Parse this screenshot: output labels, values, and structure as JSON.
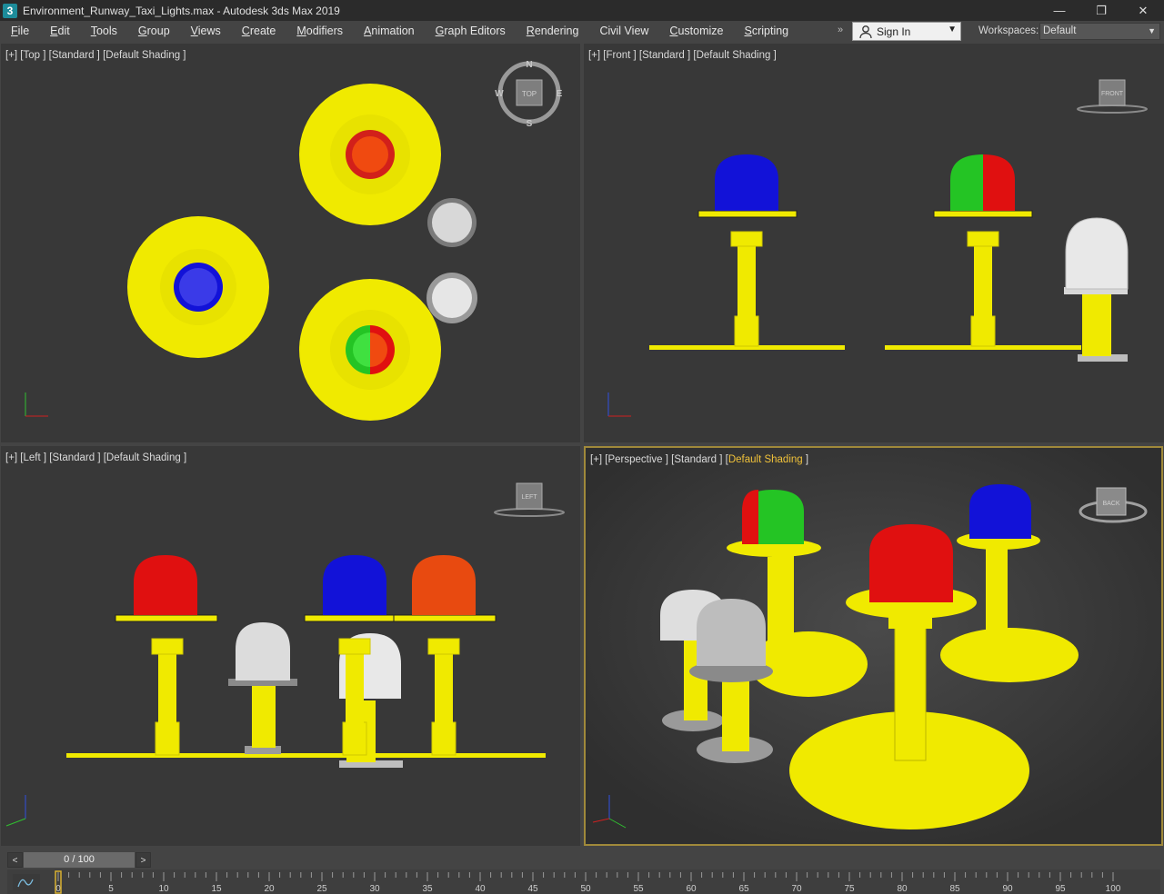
{
  "window": {
    "title": "Environment_Runway_Taxi_Lights.max - Autodesk 3ds Max 2019",
    "app_icon": "3",
    "minimize_glyph": "—",
    "restore_glyph": "❐",
    "close_glyph": "✕"
  },
  "menu": {
    "items": [
      {
        "label": "File",
        "accel": "F",
        "rest": "ile"
      },
      {
        "label": "Edit",
        "accel": "E",
        "rest": "dit"
      },
      {
        "label": "Tools",
        "accel": "T",
        "rest": "ools"
      },
      {
        "label": "Group",
        "accel": "G",
        "rest": "roup"
      },
      {
        "label": "Views",
        "accel": "V",
        "rest": "iews"
      },
      {
        "label": "Create",
        "accel": "C",
        "rest": "reate"
      },
      {
        "label": "Modifiers",
        "accel": "M",
        "rest": "odifiers"
      },
      {
        "label": "Animation",
        "accel": "A",
        "rest": "nimation"
      },
      {
        "label": "Graph Editors",
        "accel": "G",
        "rest": "raph Editors"
      },
      {
        "label": "Rendering",
        "accel": "R",
        "rest": "endering"
      },
      {
        "label": "Civil View",
        "accel": "",
        "rest": "Civil View"
      },
      {
        "label": "Customize",
        "accel": "C",
        "rest": "ustomize"
      },
      {
        "label": "Scripting",
        "accel": "S",
        "rest": "cripting"
      }
    ],
    "overflow": "»",
    "sign_in": "Sign In",
    "workspaces_label": "Workspaces:",
    "workspaces_value": "Default"
  },
  "viewports": {
    "top": {
      "label": "[+] [Top ] [Standard ] [Default Shading ]",
      "cube": "TOP",
      "n": "N",
      "s": "S",
      "e": "E",
      "w": "W"
    },
    "front": {
      "label": "[+] [Front ] [Standard ] [Default Shading ]",
      "cube": "FRONT"
    },
    "left": {
      "label": "[+] [Left ] [Standard ] [Default Shading ]",
      "cube": "LEFT"
    },
    "perspective": {
      "label_prefix": "[+] [Perspective ] [Standard ] [",
      "label_active": "Default Shading",
      "label_suffix": " ]",
      "cube": "BACK"
    }
  },
  "timeline": {
    "frame_display": "0 / 100",
    "prev": "<",
    "next": ">",
    "ticks": [
      "0",
      "5",
      "10",
      "15",
      "20",
      "25",
      "30",
      "35",
      "40",
      "45",
      "50",
      "55",
      "60",
      "65",
      "70",
      "75",
      "80",
      "85",
      "90",
      "95",
      "100"
    ]
  },
  "colors": {
    "yellow": "#f6f000",
    "red": "#e01010",
    "blue": "#1212d8",
    "green": "#24c424",
    "white": "#dcdcdc",
    "active_border": "#a0893a"
  }
}
